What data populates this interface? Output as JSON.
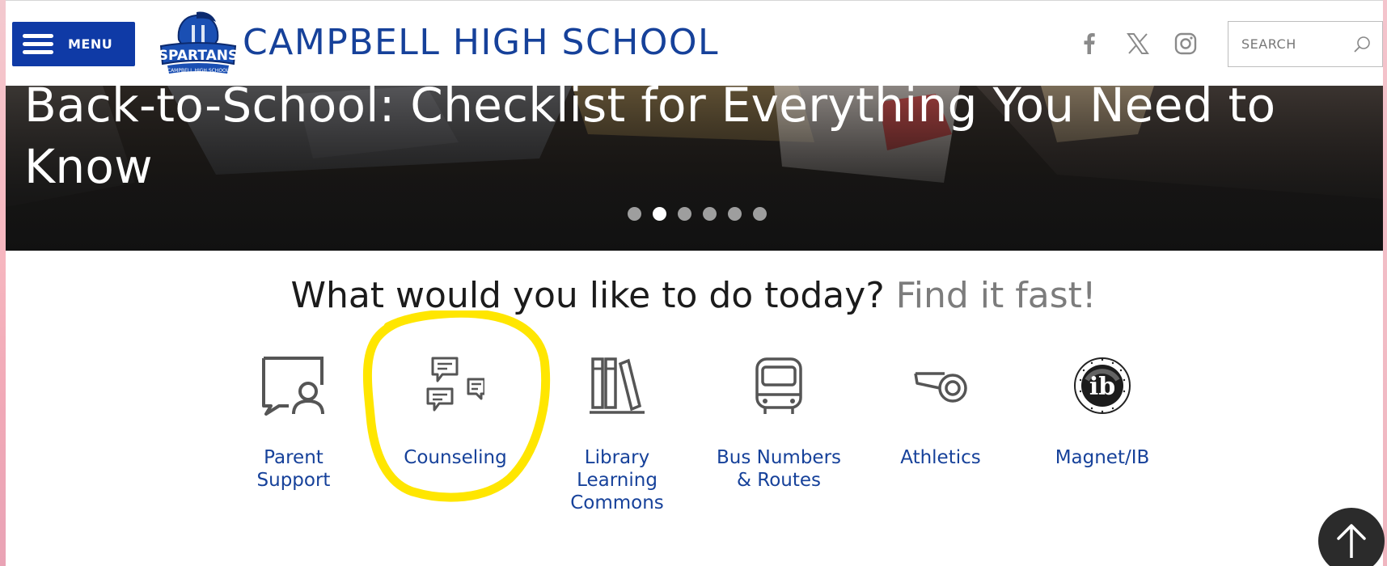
{
  "header": {
    "menu_label": "MENU",
    "school_name": "CAMPBELL HIGH SCHOOL",
    "logo_text": "SPARTANS",
    "logo_subtext": "CAMPBELL HIGH SCHOOL",
    "social": [
      "facebook-icon",
      "x-twitter-icon",
      "instagram-icon"
    ],
    "search_placeholder": "SEARCH"
  },
  "hero": {
    "title": "Back-to-School: Checklist for Everything You Need to\nKnow",
    "slides": 6,
    "active_slide": 2
  },
  "quick_links": {
    "heading": "What would you like to do today?",
    "heading_accent": "Find it fast!",
    "items": [
      {
        "label": "Parent\nSupport",
        "icon": "parent-chat-icon"
      },
      {
        "label": "Counseling",
        "icon": "chat-bubbles-icon"
      },
      {
        "label": "Library\nLearning\nCommons",
        "icon": "books-icon"
      },
      {
        "label": "Bus Numbers\n& Routes",
        "icon": "bus-icon"
      },
      {
        "label": "Athletics",
        "icon": "whistle-icon"
      },
      {
        "label": "Magnet/IB",
        "icon": "ib-logo-icon"
      }
    ]
  },
  "colors": {
    "brand_blue": "#16419a",
    "menu_blue": "#0f3aa6",
    "highlight": "#ffe600"
  }
}
